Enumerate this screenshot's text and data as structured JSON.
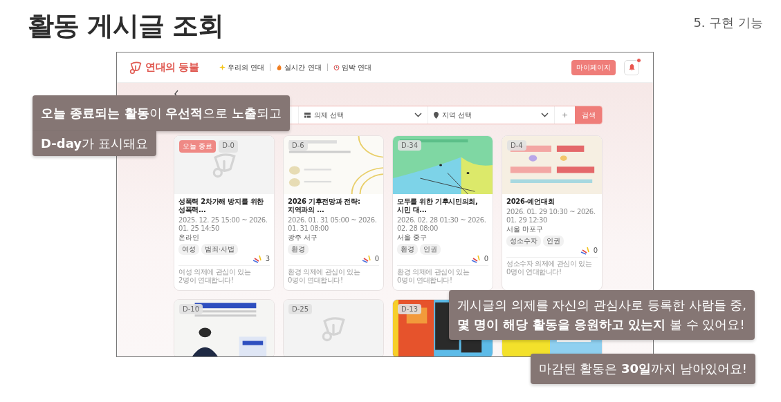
{
  "slide": {
    "title": "활동 게시글 조회",
    "section": "5. 구현 기능"
  },
  "app": {
    "logo": "연대의 등불",
    "nav": [
      {
        "label": "우리의 연대"
      },
      {
        "label": "실시간 연대"
      },
      {
        "label": "임박 연대"
      }
    ],
    "mypage": "마이페이지",
    "notification": true
  },
  "search": {
    "fields": [
      {
        "kind": "text"
      },
      {
        "kind": "select",
        "placeholder": "의제 선택"
      },
      {
        "kind": "select",
        "placeholder": "지역 선택"
      }
    ],
    "add": "+",
    "button": "검색"
  },
  "cards": [
    {
      "image": {
        "kind": "placeholder"
      },
      "badges": [
        {
          "kind": "today",
          "text": "오늘 종료"
        },
        {
          "kind": "dday",
          "text": "D-0"
        }
      ],
      "title": "성폭력 2차가해 방지를 위한 성폭력...",
      "period": "2025. 12. 25 15:00 ~ 2026. 01. 25 14:50",
      "location": "온라인",
      "tags": [
        "여성",
        "범죄·사법"
      ],
      "cheers": "3",
      "footer": "여성 의제에 관심이 있는 2명이 연대합니다!"
    },
    {
      "image": {
        "kind": "picture"
      },
      "badges": [
        {
          "kind": "dday",
          "text": "D-6"
        }
      ],
      "title": "2026 기후전망과 전략: 지역과의 ...",
      "period": "2026. 01. 31 05:00 ~ 2026. 01. 31 08:00",
      "location": "광주 서구",
      "tags": [
        "환경"
      ],
      "cheers": "0",
      "footer": "환경 의제에 관심이 있는 0명이 연대합니다!"
    },
    {
      "image": {
        "kind": "picture"
      },
      "badges": [
        {
          "kind": "dday",
          "text": "D-34"
        }
      ],
      "title": "모두를 위한 기후시민의회, 시민 대...",
      "period": "2026. 02. 28 01:30 ~ 2026. 02. 28 08:00",
      "location": "서울 중구",
      "tags": [
        "환경",
        "인권"
      ],
      "cheers": "0",
      "footer": "환경 의제에 관심이 있는 0명이 연대합니다!"
    },
    {
      "image": {
        "kind": "picture"
      },
      "badges": [
        {
          "kind": "dday",
          "text": "D-4"
        }
      ],
      "title": "2026-예언대회",
      "period": "2026. 01. 29 10:30 ~ 2026. 01. 29 12:30",
      "location": "서울 마포구",
      "tags": [
        "성소수자",
        "인권"
      ],
      "cheers": "0",
      "footer": "성소수자 의제에 관심이 있는 0명이 연대합니다!"
    },
    {
      "image": {
        "kind": "picture"
      },
      "badges": [
        {
          "kind": "dday",
          "text": "D-10"
        }
      ]
    },
    {
      "image": {
        "kind": "placeholder"
      },
      "badges": [
        {
          "kind": "dday",
          "text": "D-25"
        }
      ]
    },
    {
      "image": {
        "kind": "picture"
      },
      "badges": [
        {
          "kind": "dday",
          "text": "D-13"
        }
      ]
    },
    {
      "image": {
        "kind": "picture"
      }
    }
  ],
  "callouts": [
    {
      "kind": "stepped",
      "lines": [
        "**오늘 종료되는 활동**이 **우선적**으로 **노출**되고",
        "**D-day**가 표시돼요"
      ]
    },
    {
      "kind": "block",
      "lines": [
        "게시글의 의제를 자신의 관심사로 등록한 사람들 중,",
        "**몇 명이 해당 활동을 응원하고 있는지** 볼 수 있어요!"
      ]
    },
    {
      "kind": "block",
      "lines": [
        "마감된 활동은 **30일**까지 남아있어요!"
      ]
    }
  ]
}
